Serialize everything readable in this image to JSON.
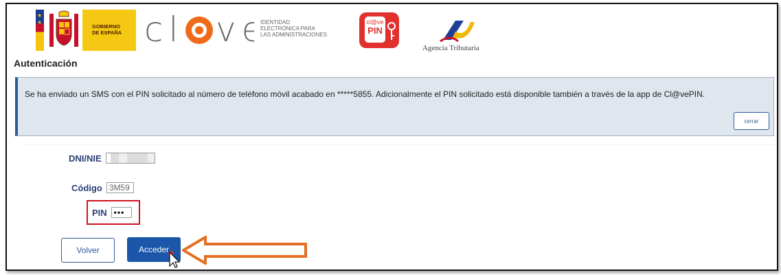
{
  "header": {
    "gov_label_line1": "GOBIERNO",
    "gov_label_line2": "DE ESPAÑA",
    "clave_logo_text": "cl@ve",
    "clave_sub_line1": "IDENTIDAD",
    "clave_sub_line2": "ELECTRÓNICA PARA",
    "clave_sub_line3": "LAS ADMINISTRACIONES",
    "clavepin_top": "cl@ve",
    "clavepin_bottom": "PIN",
    "agencia_text": "Agencia Tributaria"
  },
  "page": {
    "title": "Autenticación"
  },
  "notice": {
    "message": "Se ha enviado un SMS con el PIN solicitado al número de teléfono móvil acabado en *****5855. Adicionalmente el PIN solicitado está disponible también a través de la app de Cl@vePIN.",
    "close_label": "cerrar"
  },
  "form": {
    "dni_label": "DNI/NIE",
    "codigo_label": "Código",
    "codigo_value": "3M59",
    "pin_label": "PIN",
    "pin_value": "•••"
  },
  "actions": {
    "volver_label": "Volver",
    "acceder_label": "Acceder"
  },
  "colors": {
    "accent_blue": "#1b56a8",
    "highlight_red": "#d0101e",
    "arrow_orange": "#e46f24",
    "notice_bg": "#dfe6ee"
  }
}
